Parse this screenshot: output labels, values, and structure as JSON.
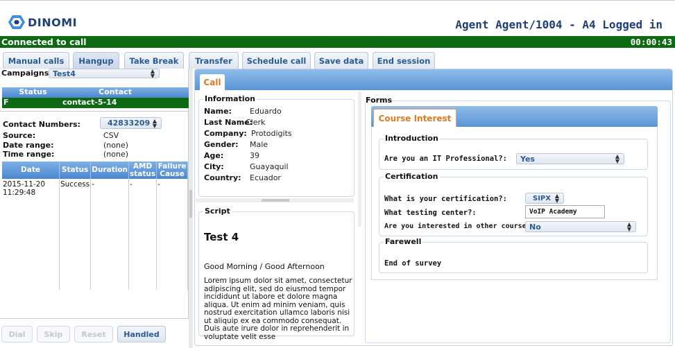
{
  "header": {
    "logo_text": "DINOMI",
    "agent_title": "Agent Agent/1004 - A4 Logged in"
  },
  "status": {
    "text": "Connected to call",
    "timer": "00:00:43",
    "color": "#0e6a12"
  },
  "toolbar": {
    "buttons": [
      {
        "label": "Manual calls"
      },
      {
        "label": "Hangup"
      },
      {
        "label": "Take Break"
      },
      {
        "label": "Transfer"
      },
      {
        "label": "Schedule call"
      },
      {
        "label": "Save data"
      },
      {
        "label": "End session"
      }
    ]
  },
  "left": {
    "campaigns_label": "Campaigns:",
    "campaign_selected": "Test4",
    "status_table": {
      "headers": [
        "Status",
        "Contact"
      ],
      "row": {
        "status": "F",
        "contact": "contact-5-14"
      }
    },
    "contact_numbers_label": "Contact Numbers:",
    "contact_number_selected": "42833209",
    "source_label": "Source:",
    "source_value": "CSV",
    "date_range_label": "Date range:",
    "date_range_value": "(none)",
    "time_range_label": "Time range:",
    "time_range_value": "(none)",
    "calls_table": {
      "headers": [
        "Date",
        "Status",
        "Duration",
        "AMD status",
        "Failure Cause"
      ],
      "rows": [
        {
          "date": "2015-11-20 11:29:48",
          "status": "Success",
          "duration": "-",
          "amd": "-",
          "failure": "-"
        }
      ]
    },
    "bottom_buttons": [
      {
        "label": "Dial"
      },
      {
        "label": "Skip"
      },
      {
        "label": "Reset"
      },
      {
        "label": "Handled"
      }
    ]
  },
  "right": {
    "call_tab": "Call",
    "information": {
      "legend": "Information",
      "fields": [
        {
          "label": "Name:",
          "value": "Eduardo"
        },
        {
          "label": "Last Name:",
          "value": "Clerk"
        },
        {
          "label": "Company:",
          "value": "Protodigits"
        },
        {
          "label": "Gender:",
          "value": "Male"
        },
        {
          "label": "Age:",
          "value": "39"
        },
        {
          "label": "City:",
          "value": "Guayaquil"
        },
        {
          "label": "Country:",
          "value": "Ecuador"
        }
      ]
    },
    "script": {
      "legend": "Script",
      "title": "Test 4",
      "greeting": "Good Morning / Good Afternoon",
      "body": "Lorem ipsum dolor sit amet, consectetur adipiscing elit, sed do eiusmod tempor incididunt ut labore et dolore magna aliqua. Ut enim ad minim veniam, quis nostrud exercitation ullamco laboris nisi ut aliquip ex ea commodo consequat. Duis aute irure dolor in reprehenderit in voluptate velit esse"
    },
    "forms": {
      "legend": "Forms",
      "tab": "Course Interest",
      "introduction": {
        "legend": "Introduction",
        "question": "Are you an IT Professional?:",
        "answer": "Yes"
      },
      "certification": {
        "legend": "Certification",
        "q1": "What is your certification?:",
        "a1": "SIPX",
        "q2": "What testing center?:",
        "a2": "VoIP Academy",
        "q3": "Are you interested in other course?:",
        "a3": "No"
      },
      "farewell": {
        "legend": "Farewell",
        "text": "End of survey"
      }
    }
  }
}
